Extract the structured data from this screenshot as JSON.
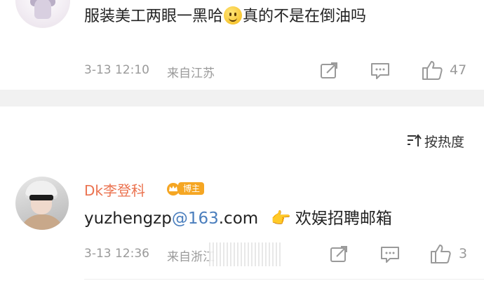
{
  "comments": [
    {
      "text_before": "服装美工两眼一黑哈",
      "emoji": "smile",
      "text_after": "真的不是在倒油吗",
      "time": "3-13 12:10",
      "source": "来自江苏",
      "likes": "47"
    },
    {
      "username": "Dk李登科",
      "badge_label": "博主",
      "email_user": "yuzhengzp",
      "email_at": "@",
      "email_domain": "163",
      "email_tld": ".com",
      "hand_emoji": "👉",
      "text_after": "欢娱招聘邮箱",
      "time": "3-13 12:36",
      "source": "来自浙江",
      "likes": "3"
    }
  ],
  "sort": {
    "label": "按热度"
  },
  "colors": {
    "username": "#eb7350",
    "link": "#4a7ebd",
    "meta": "#9a9a9a",
    "badge": "#f5a623"
  }
}
